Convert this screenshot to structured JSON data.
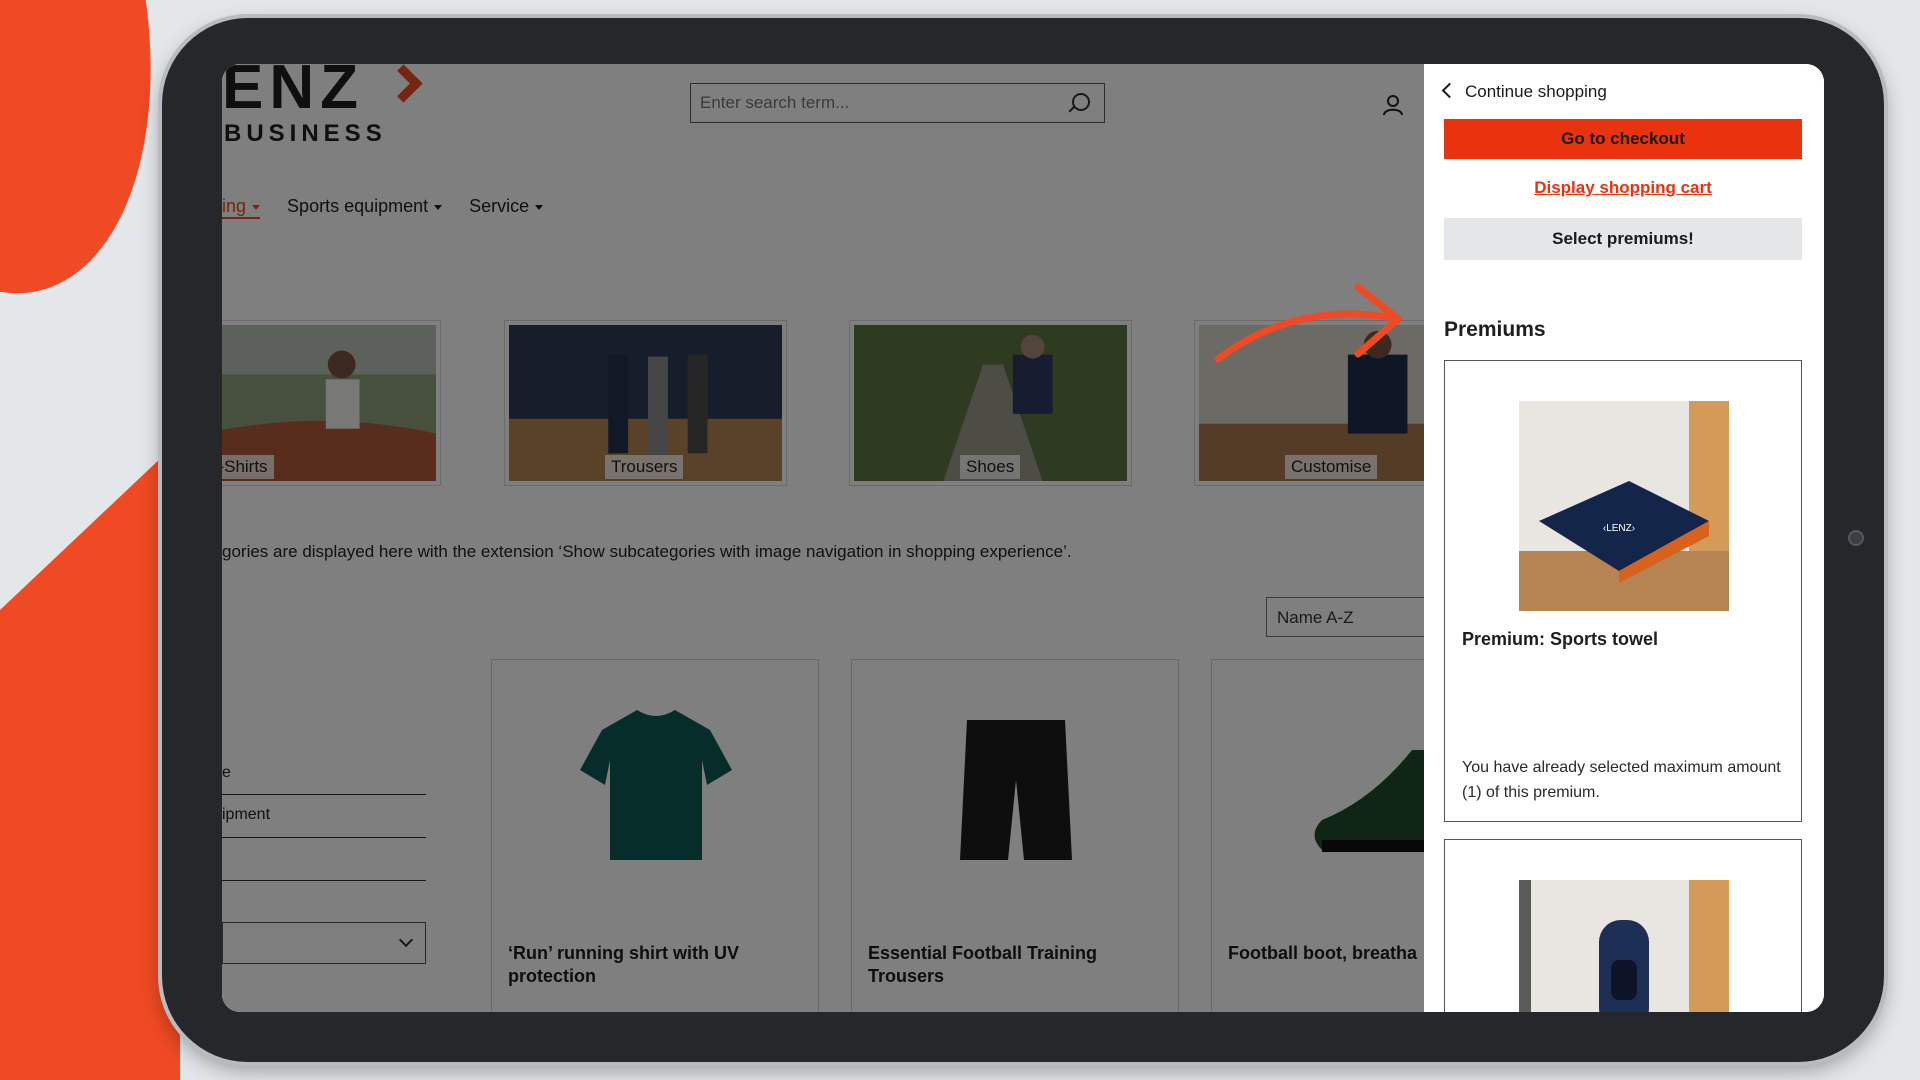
{
  "header": {
    "logo_text": "ENZ",
    "logo_sub": "BUSINESS",
    "search_placeholder": "Enter search term..."
  },
  "nav": {
    "items": [
      {
        "label": "ing"
      },
      {
        "label": "Sports equipment"
      },
      {
        "label": "Service"
      }
    ]
  },
  "categories": [
    {
      "label": "T-Shirts"
    },
    {
      "label": "Trousers"
    },
    {
      "label": "Shoes"
    },
    {
      "label": "Customise"
    }
  ],
  "description": "gories are displayed here with the extension ‘Show subcategories with image navigation in shopping experience’.",
  "sort": {
    "selected": "Name A-Z"
  },
  "filters": {
    "item1": "e",
    "item2": "ipment"
  },
  "products": [
    {
      "name": "‘Run’ running shirt with UV protection"
    },
    {
      "name": "Essential Football Training Trousers"
    },
    {
      "name": "Football boot, breatha"
    }
  ],
  "offcanvas": {
    "continue_label": "Continue shopping",
    "checkout_label": "Go to checkout",
    "cart_link": "Display shopping cart",
    "premiums_button": "Select premiums!",
    "premiums_title": "Premiums",
    "premium_items": [
      {
        "title": "Premium: Sports towel",
        "note": "You have already selected maximum amount (1) of this premium."
      },
      {
        "title": "",
        "note": ""
      }
    ]
  },
  "colors": {
    "accent": "#ef4a23",
    "checkout": "#e9320e",
    "overlay": "rgba(0,0,0,0.5)"
  }
}
